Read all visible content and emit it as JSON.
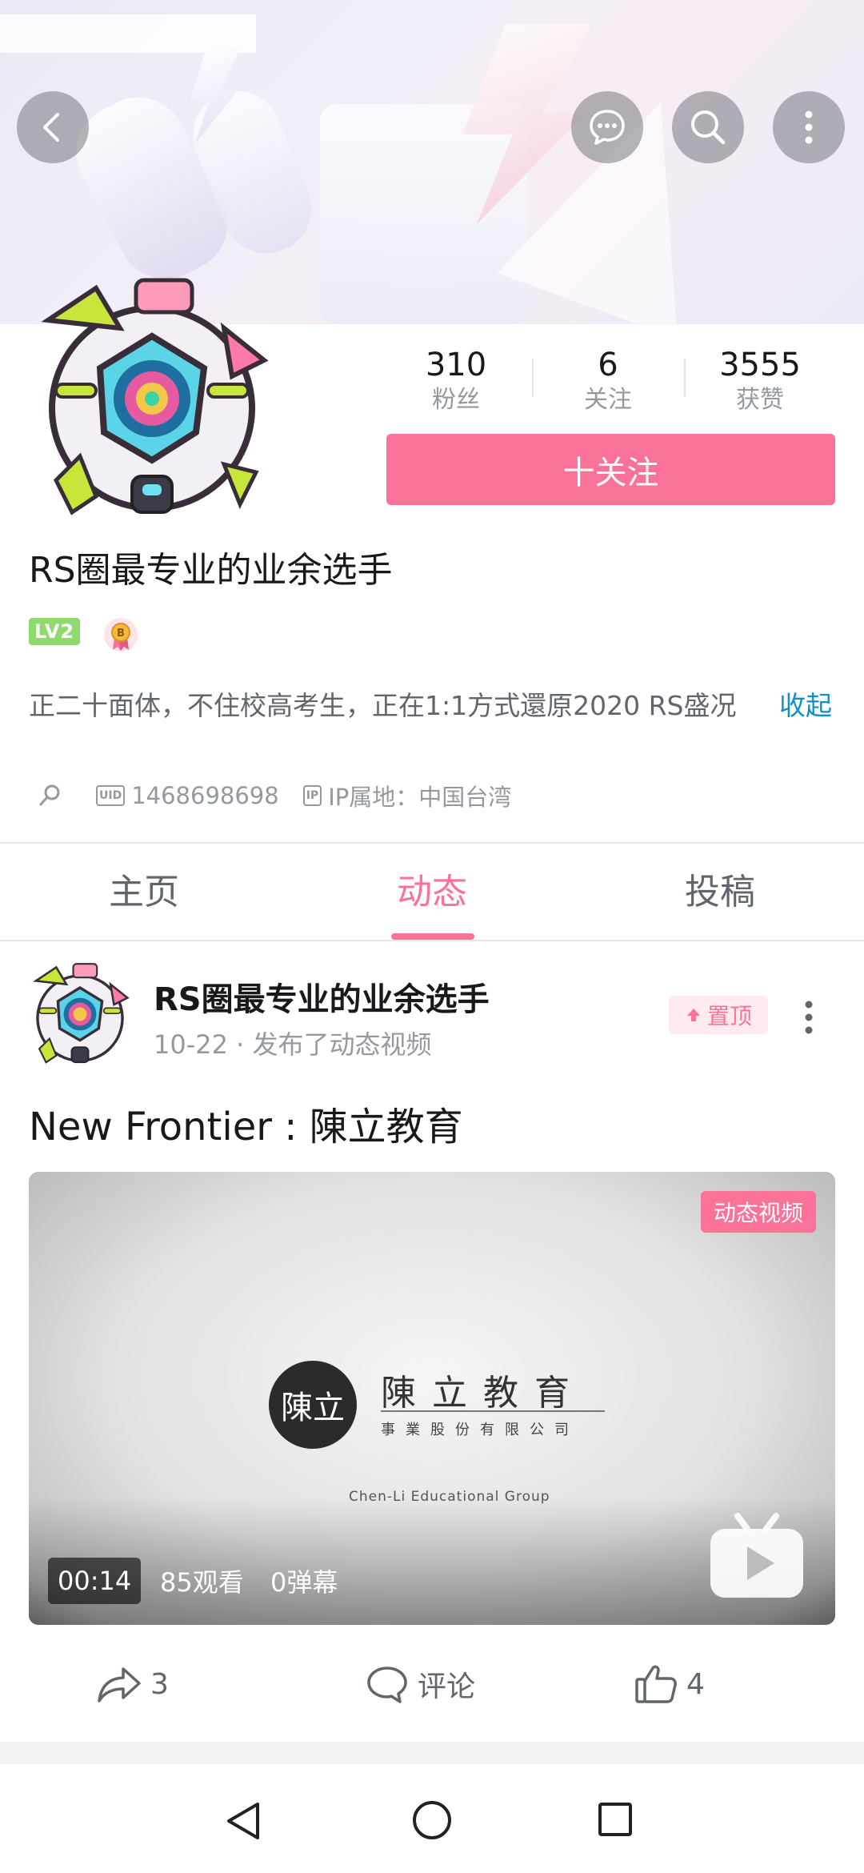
{
  "header": {
    "back_icon": "chevron-left-icon",
    "message_icon": "chat-bubble-icon",
    "search_icon": "search-icon",
    "more_icon": "more-vertical-icon"
  },
  "profile": {
    "stats": [
      {
        "value": "310",
        "label": "粉丝"
      },
      {
        "value": "6",
        "label": "关注"
      },
      {
        "value": "3555",
        "label": "获赞"
      }
    ],
    "follow_label": "十关注",
    "username": "RS圈最专业的业余选手",
    "level": "LV2",
    "bio": "正二十面体，不住校高考生，正在1:1方式還原2020 RS盛况",
    "collapse_label": "收起",
    "uid_chip": "UID",
    "uid": "1468698698",
    "ip_chip": "IP",
    "ip_location": "IP属地：中国台湾"
  },
  "tabs": [
    {
      "label": "主页",
      "active": false
    },
    {
      "label": "动态",
      "active": true
    },
    {
      "label": "投稿",
      "active": false
    }
  ],
  "post": {
    "author": "RS圈最专业的业余选手",
    "date": "10-22",
    "action_text": "· 发布了动态视频",
    "pin_label": "置顶",
    "text": "New Frontier : 陳立教育",
    "video": {
      "tag": "动态视频",
      "logo_mark": "陳立",
      "logo_cn": "陳立教育",
      "logo_cn_sub": "事業股份有限公司",
      "logo_en": "Chen-Li Educational Group",
      "duration": "00:14",
      "views": "85观看",
      "danmaku": "0弹幕"
    },
    "share_count": "3",
    "comment_label": "评论",
    "like_count": "4"
  },
  "colors": {
    "accent": "#fb7299",
    "link": "#0e8fc7",
    "level_badge": "#8fd96f"
  }
}
